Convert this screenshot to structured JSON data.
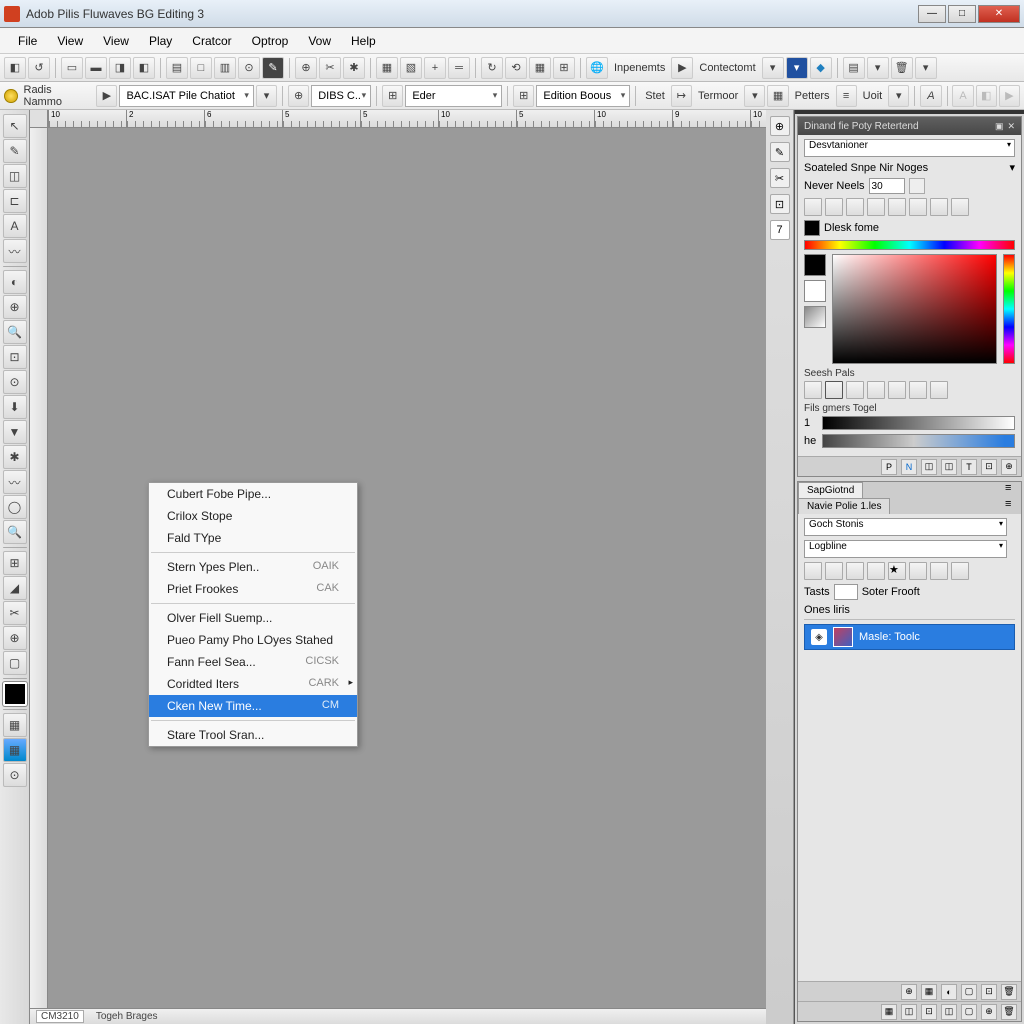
{
  "window": {
    "title": "Adob Pilis Fluwaves BG Editing 3"
  },
  "menu": [
    "File",
    "View",
    "View",
    "Play",
    "Cratcor",
    "Optrop",
    "Vow",
    "Help"
  ],
  "toolbar2": {
    "radio_label": "Radis Nammo",
    "dd1": "BAC.ISAT Pile Chatiot",
    "dd2": "DIBS C..",
    "dd3": "Eder",
    "dd4": "Edition Boous",
    "stet": "Stet",
    "termoor": "Termoor",
    "peters": "Petters",
    "uoit": "Uoit"
  },
  "toolbar1": {
    "inpenents": "Inpenemts",
    "contectomt": "Contectomt"
  },
  "ruler_ticks": [
    "10",
    "2",
    "6",
    "5",
    "5",
    "10",
    "5",
    "10",
    "9",
    "10"
  ],
  "status": {
    "zoom": "CM3210",
    "label": "Togeh Brages"
  },
  "context_menu": [
    {
      "label": "Cubert Fobe Pipe...",
      "shortcut": ""
    },
    {
      "label": "Crilox Stope",
      "shortcut": ""
    },
    {
      "label": "Fald TYpe",
      "shortcut": ""
    },
    {
      "sep": true
    },
    {
      "label": "Stern Ypes Plen..",
      "shortcut": "OAIK"
    },
    {
      "label": "Priet Frookes",
      "shortcut": "CAK"
    },
    {
      "sep": true
    },
    {
      "label": "Olver Fiell Suemp...",
      "shortcut": ""
    },
    {
      "label": "Pueo Pamy Pho LOyes Stahed",
      "shortcut": ""
    },
    {
      "label": "Fann Feel Sea...",
      "shortcut": "CICSK"
    },
    {
      "label": "Coridted Iters",
      "shortcut": "CARK",
      "arrow": true
    },
    {
      "label": "Cken New Time...",
      "shortcut": "CM",
      "highlighted": true
    },
    {
      "sep": true
    },
    {
      "label": "Stare Trool Sran...",
      "shortcut": ""
    }
  ],
  "right": {
    "panel1": {
      "title": "Dinand fie Poty Retertend",
      "dd": "Desvtanioner",
      "row_label": "Soateled Snpe Nir Noges",
      "never_label": "Never Neels",
      "never_value": "30",
      "swatch_label": "Dlesk fome",
      "section_seesh": "Seesh Pals",
      "section_fils": "Fils gmers Togel",
      "grad1_label": "1",
      "grad2_label": "he"
    },
    "panel2": {
      "tab1": "SapGiotnd",
      "tab2": "Navie Polie 1.les",
      "dd1": "Goch Stonis",
      "dd2": "Logbline",
      "tasts": "Tasts",
      "soter": "Soter Frooft",
      "ones": "Ones liris",
      "layer_name": "Masle: Toolc"
    }
  }
}
